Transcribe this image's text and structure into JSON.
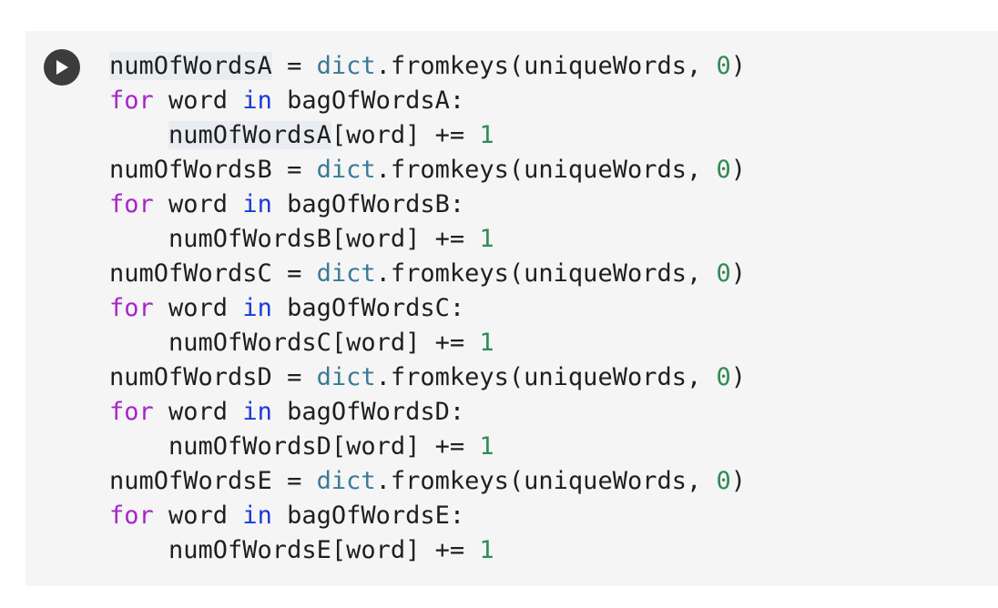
{
  "cell": {
    "run_button_icon": "play-icon",
    "lines": [
      [
        {
          "text": "numOfWordsA",
          "type": "plain",
          "highlight": true
        },
        {
          "text": " = ",
          "type": "plain"
        },
        {
          "text": "dict",
          "type": "builtin"
        },
        {
          "text": ".fromkeys(uniqueWords, ",
          "type": "plain"
        },
        {
          "text": "0",
          "type": "number"
        },
        {
          "text": ")",
          "type": "plain"
        }
      ],
      [
        {
          "text": "for",
          "type": "keyword"
        },
        {
          "text": " word ",
          "type": "plain"
        },
        {
          "text": "in",
          "type": "keyword2"
        },
        {
          "text": " bagOfWordsA:",
          "type": "plain"
        }
      ],
      [
        {
          "text": "    ",
          "type": "plain"
        },
        {
          "text": "numOfWordsA",
          "type": "plain",
          "highlight": true
        },
        {
          "text": "[word] += ",
          "type": "plain"
        },
        {
          "text": "1",
          "type": "number"
        }
      ],
      [
        {
          "text": "numOfWordsB = ",
          "type": "plain"
        },
        {
          "text": "dict",
          "type": "builtin"
        },
        {
          "text": ".fromkeys(uniqueWords, ",
          "type": "plain"
        },
        {
          "text": "0",
          "type": "number"
        },
        {
          "text": ")",
          "type": "plain"
        }
      ],
      [
        {
          "text": "for",
          "type": "keyword"
        },
        {
          "text": " word ",
          "type": "plain"
        },
        {
          "text": "in",
          "type": "keyword2"
        },
        {
          "text": " bagOfWordsB:",
          "type": "plain"
        }
      ],
      [
        {
          "text": "    numOfWordsB[word] += ",
          "type": "plain"
        },
        {
          "text": "1",
          "type": "number"
        }
      ],
      [
        {
          "text": "numOfWordsC = ",
          "type": "plain"
        },
        {
          "text": "dict",
          "type": "builtin"
        },
        {
          "text": ".fromkeys(uniqueWords, ",
          "type": "plain"
        },
        {
          "text": "0",
          "type": "number"
        },
        {
          "text": ")",
          "type": "plain"
        }
      ],
      [
        {
          "text": "for",
          "type": "keyword"
        },
        {
          "text": " word ",
          "type": "plain"
        },
        {
          "text": "in",
          "type": "keyword2"
        },
        {
          "text": " bagOfWordsC:",
          "type": "plain"
        }
      ],
      [
        {
          "text": "    numOfWordsC[word] += ",
          "type": "plain"
        },
        {
          "text": "1",
          "type": "number"
        }
      ],
      [
        {
          "text": "numOfWordsD = ",
          "type": "plain"
        },
        {
          "text": "dict",
          "type": "builtin"
        },
        {
          "text": ".fromkeys(uniqueWords, ",
          "type": "plain"
        },
        {
          "text": "0",
          "type": "number"
        },
        {
          "text": ")",
          "type": "plain"
        }
      ],
      [
        {
          "text": "for",
          "type": "keyword"
        },
        {
          "text": " word ",
          "type": "plain"
        },
        {
          "text": "in",
          "type": "keyword2"
        },
        {
          "text": " bagOfWordsD:",
          "type": "plain"
        }
      ],
      [
        {
          "text": "    numOfWordsD[word] += ",
          "type": "plain"
        },
        {
          "text": "1",
          "type": "number"
        }
      ],
      [
        {
          "text": "numOfWordsE = ",
          "type": "plain"
        },
        {
          "text": "dict",
          "type": "builtin"
        },
        {
          "text": ".fromkeys(uniqueWords, ",
          "type": "plain"
        },
        {
          "text": "0",
          "type": "number"
        },
        {
          "text": ")",
          "type": "plain"
        }
      ],
      [
        {
          "text": "for",
          "type": "keyword"
        },
        {
          "text": " word ",
          "type": "plain"
        },
        {
          "text": "in",
          "type": "keyword2"
        },
        {
          "text": " bagOfWordsE:",
          "type": "plain"
        }
      ],
      [
        {
          "text": "    numOfWordsE[word] += ",
          "type": "plain"
        },
        {
          "text": "1",
          "type": "number"
        }
      ]
    ]
  },
  "colors": {
    "keyword": "#a626c8",
    "keyword2": "#1b3ad6",
    "builtin": "#3a7a96",
    "number": "#2e8b57",
    "plain": "#1f1f1f",
    "cell_background": "#f5f5f5",
    "run_button": "#3c3c3c"
  }
}
